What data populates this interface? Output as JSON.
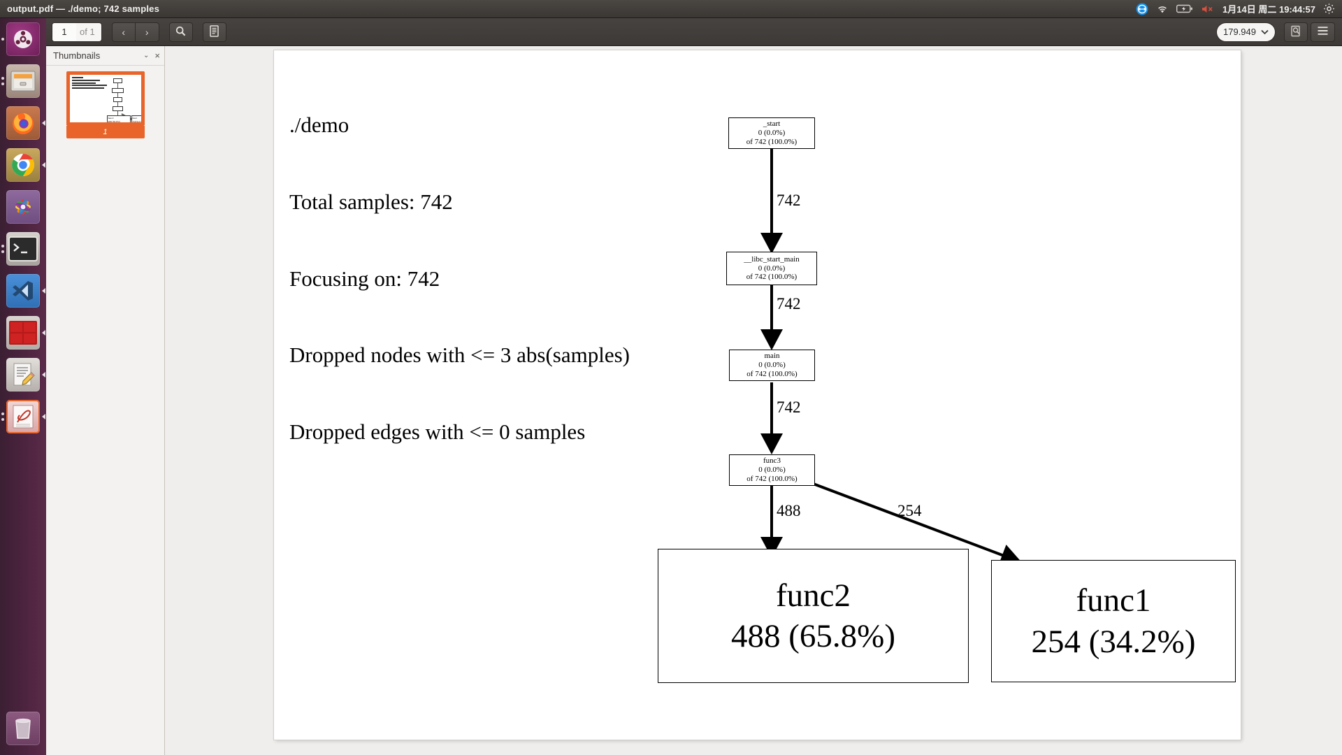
{
  "window": {
    "title": "output.pdf — ./demo; 742 samples"
  },
  "tray": {
    "items": [
      "teamviewer-icon",
      "wifi-icon",
      "battery-icon",
      "volume-muted-icon",
      "gear-icon"
    ],
    "clock": "1月14日 周二 19:44:57"
  },
  "launcher": {
    "items": [
      {
        "name": "ubuntu-dash",
        "label": "Ubuntu Dash"
      },
      {
        "name": "files",
        "label": "Files"
      },
      {
        "name": "firefox",
        "label": "Firefox"
      },
      {
        "name": "chrome",
        "label": "Google Chrome"
      },
      {
        "name": "photos",
        "label": "Photos"
      },
      {
        "name": "terminal",
        "label": "Terminal"
      },
      {
        "name": "vscode",
        "label": "Visual Studio Code"
      },
      {
        "name": "red-app",
        "label": "Screen Recorder"
      },
      {
        "name": "text-editor",
        "label": "Text Editor"
      },
      {
        "name": "evince",
        "label": "Document Viewer"
      }
    ],
    "trash": {
      "name": "trash",
      "label": "Trash"
    }
  },
  "toolbar": {
    "page_number": "1",
    "page_total": "of 1",
    "prev_label": "‹",
    "next_label": "›",
    "search_icon": "search-icon",
    "annotations_icon": "annotations-icon",
    "zoom_value": "179.949",
    "zoom_chevron": "⌄",
    "find_icon": "find-icon",
    "menu_icon": "hamburger-menu-icon"
  },
  "sidebar": {
    "title": "Thumbnails",
    "chevron": "⌄",
    "close": "×",
    "thumbnails": [
      {
        "page_label": "1",
        "selected": true
      }
    ]
  },
  "document": {
    "header_lines": [
      "./demo",
      "Total samples: 742",
      "Focusing on: 742",
      "Dropped nodes with <= 3 abs(samples)",
      "Dropped edges with <= 0 samples"
    ],
    "graph": {
      "nodes": [
        {
          "id": "start",
          "name": "_start",
          "self": "0 (0.0%)",
          "total": "of 742 (100.0%)",
          "size": "small"
        },
        {
          "id": "libc",
          "name": "__libc_start_main",
          "self": "0 (0.0%)",
          "total": "of 742 (100.0%)",
          "size": "small"
        },
        {
          "id": "main",
          "name": "main",
          "self": "0 (0.0%)",
          "total": "of 742 (100.0%)",
          "size": "small"
        },
        {
          "id": "func3",
          "name": "func3",
          "self": "0 (0.0%)",
          "total": "of 742 (100.0%)",
          "size": "small"
        },
        {
          "id": "func2",
          "name": "func2",
          "self": "488 (65.8%)",
          "total": "",
          "size": "big"
        },
        {
          "id": "func1",
          "name": "func1",
          "self": "254 (34.2%)",
          "total": "",
          "size": "big"
        }
      ],
      "edges": [
        {
          "from": "start",
          "to": "libc",
          "label": "742"
        },
        {
          "from": "libc",
          "to": "main",
          "label": "742"
        },
        {
          "from": "main",
          "to": "func3",
          "label": "742"
        },
        {
          "from": "func3",
          "to": "func2",
          "label": "488"
        },
        {
          "from": "func3",
          "to": "func1",
          "label": "254"
        }
      ]
    }
  },
  "colors": {
    "accent": "#e8642a",
    "panel": "#3d3936",
    "launcher": "#5b2b4a",
    "page": "#ffffff"
  }
}
